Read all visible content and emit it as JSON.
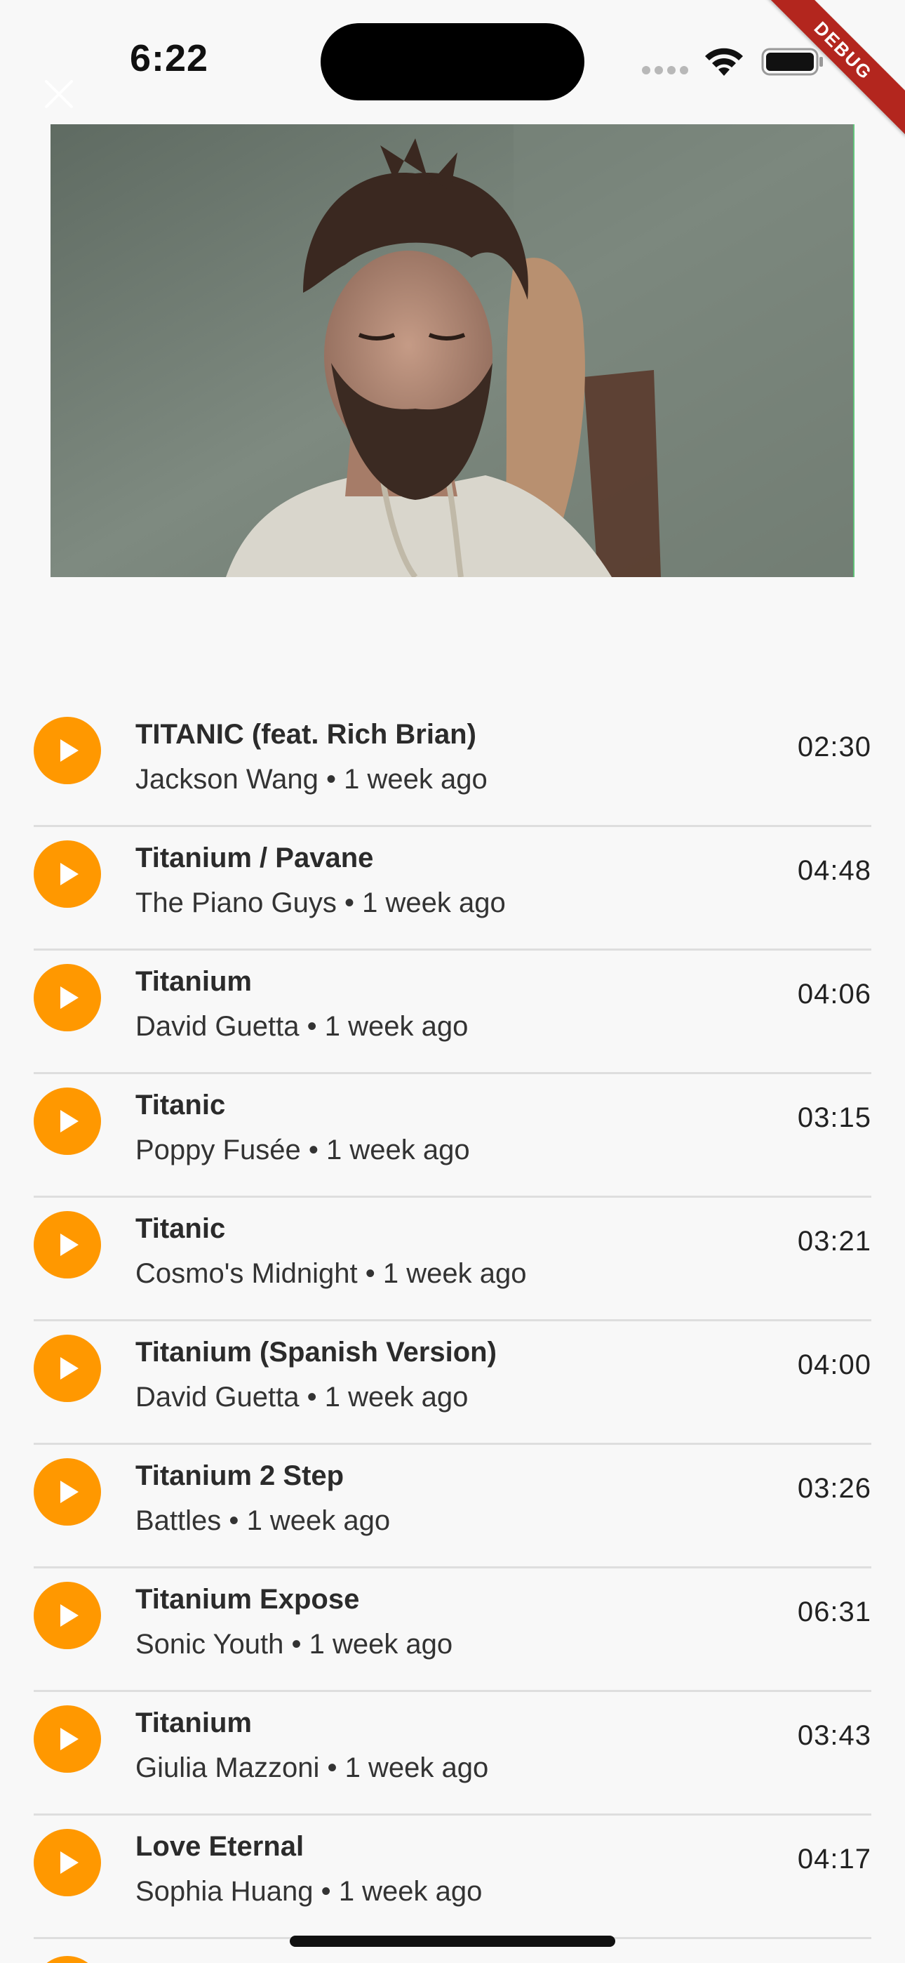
{
  "status_bar": {
    "time": "6:22",
    "debug_label": "DEBUG"
  },
  "icons": {
    "close": "close-icon",
    "play": "play-icon",
    "wifi": "wifi-icon",
    "battery": "battery-icon"
  },
  "colors": {
    "accent": "#ff9800",
    "background": "#f8f8f8",
    "divider": "#dedede"
  },
  "songs": [
    {
      "title": "TITANIC (feat. Rich Brian)",
      "artist": "Jackson Wang",
      "separator": "•",
      "age": "1 week ago",
      "duration": "02:30"
    },
    {
      "title": "Titanium / Pavane",
      "artist": "The Piano Guys",
      "separator": "•",
      "age": "1 week ago",
      "duration": "04:48"
    },
    {
      "title": "Titanium",
      "artist": "David Guetta",
      "separator": "•",
      "age": "1 week ago",
      "duration": "04:06"
    },
    {
      "title": "Titanic",
      "artist": "Poppy Fusée",
      "separator": "•",
      "age": "1 week ago",
      "duration": "03:15"
    },
    {
      "title": "Titanic",
      "artist": "Cosmo's Midnight",
      "separator": "•",
      "age": "1 week ago",
      "duration": "03:21"
    },
    {
      "title": "Titanium (Spanish Version)",
      "artist": "David Guetta",
      "separator": "•",
      "age": "1 week ago",
      "duration": "04:00"
    },
    {
      "title": "Titanium 2 Step",
      "artist": "Battles",
      "separator": "•",
      "age": "1 week ago",
      "duration": "03:26"
    },
    {
      "title": "Titanium Expose",
      "artist": "Sonic Youth",
      "separator": "•",
      "age": "1 week ago",
      "duration": "06:31"
    },
    {
      "title": "Titanium",
      "artist": "Giulia Mazzoni",
      "separator": "•",
      "age": "1 week ago",
      "duration": "03:43"
    },
    {
      "title": "Love Eternal",
      "artist": "Sophia Huang",
      "separator": "•",
      "age": "1 week ago",
      "duration": "04:17"
    }
  ]
}
